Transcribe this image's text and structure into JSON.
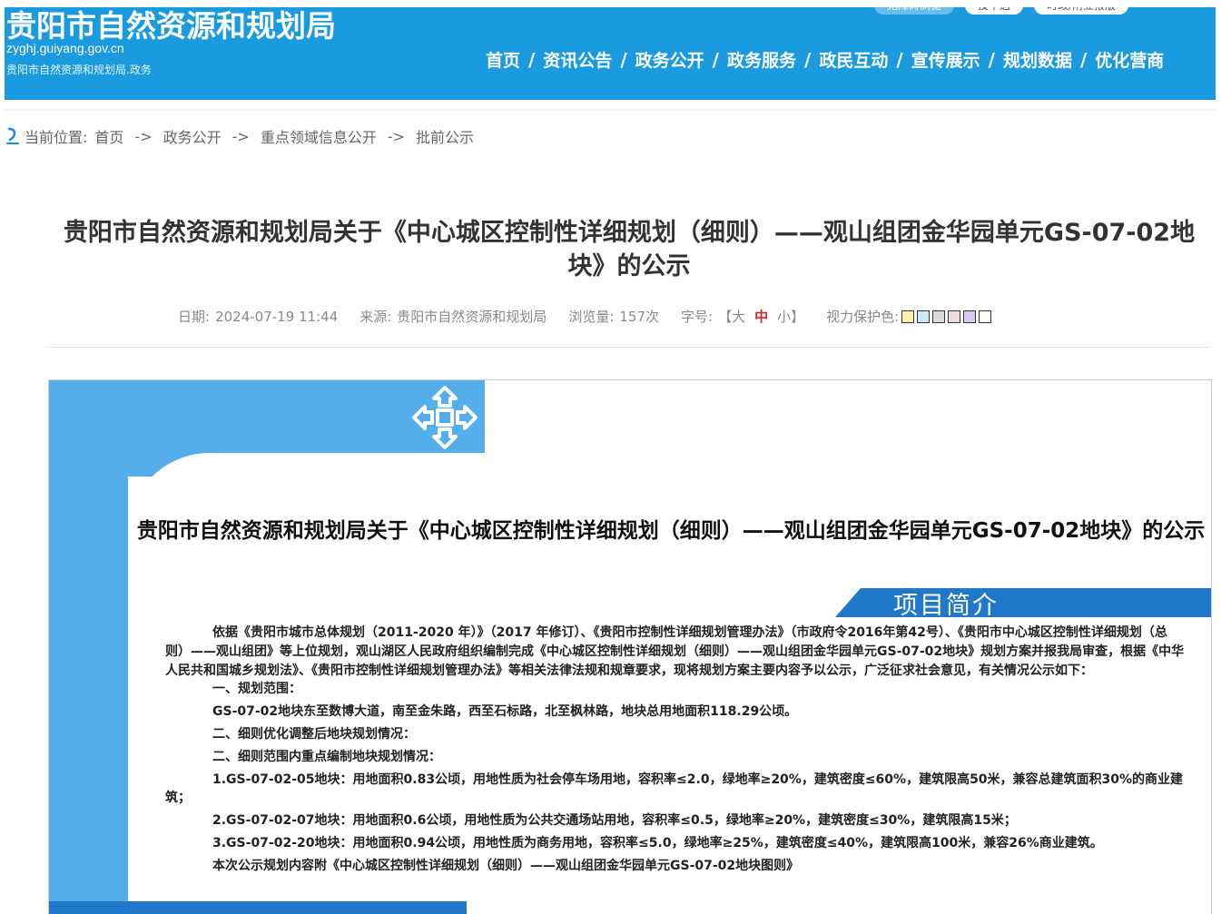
{
  "header": {
    "site_title": "贵阳市自然资源和规划局",
    "domain": "zyghj.guiyang.gov.cn",
    "subtitle": "贵阳市自然资源和规划局.政务",
    "top_tabs": [
      "无障碍浏览",
      "投中遇",
      "时政/附立报版"
    ],
    "nav": [
      "首页",
      "资讯公告",
      "政务公开",
      "政务服务",
      "政民互动",
      "宣传展示",
      "规划数据",
      "优化营商"
    ],
    "nav_separator": "/",
    "bg_color": "#1a9be0"
  },
  "breadcrumb": {
    "label": "当前位置:",
    "items": [
      "首页",
      "政务公开",
      "重点领域信息公开",
      "批前公示"
    ],
    "arrow": "->"
  },
  "article": {
    "title": "贵阳市自然资源和规划局关于《中心城区控制性详细规划（细则）——观山组团金华园单元GS-07-02地块》的公示",
    "date_label": "日期:",
    "date": "2024-07-19 11:44",
    "source_label": "来源:",
    "source": "贵阳市自然资源和规划局",
    "views_label": "浏览量:",
    "views": "157次",
    "font_label": "字号:",
    "font_open": "【大",
    "font_mid": "中",
    "font_close": "小】",
    "eye_label": "视力保护色:",
    "eye_colors": [
      "#fbf1a8",
      "#c9ecf6",
      "#dcdcdc",
      "#f2d9e6",
      "#d9c8f3",
      "#ffffff"
    ]
  },
  "poster": {
    "title": "贵阳市自然资源和规划局关于《中心城区控制性详细规划（细则）——观山组团金华园单元GS-07-02地块》的公示",
    "section": "项目简介",
    "intro": "依据《贵阳市城市总体规划（2011-2020 年）》（2017 年修订）、《贵阳市控制性详细规划管理办法》（市政府令2016年第42号）、《贵阳市中心城区控制性详细规划（总则）——观山组团》等上位规划，观山湖区人民政府组织编制完成《中心城区控制性详细规划（细则）——观山组团金华园单元GS-07-02地块》规划方案并报我局审查，根据《中华人民共和国城乡规划法》、《贵阳市控制性详细规划管理办法》等相关法律法规和规章要求，现将规划方案主要内容予以公示，广泛征求社会意见，有关情况公示如下：",
    "s1": "一、规划范围：",
    "s1_text": "GS-07-02地块东至数博大道，南至金朱路，西至石标路，北至枫林路，地块总用地面积118.29公顷。",
    "s2": "二、细则优化调整后地块规划情况：",
    "s3": "二、细则范围内重点编制地块规划情况：",
    "item1": "1.GS-07-02-05地块：用地面积0.83公顷，用地性质为社会停车场用地，容积率≤2.0，绿地率≥20%，建筑密度≤60%，建筑限高50米，兼容总建筑面积30%的商业建筑；",
    "item2": "2.GS-07-02-07地块：用地面积0.6公顷，用地性质为公共交通场站用地，容积率≤0.5，绿地率≥20%，建筑密度≤30%，建筑限高15米；",
    "item3": "3.GS-07-02-20地块：用地面积0.94公顷，用地性质为商务用地，容积率≤5.0，绿地率≥25%，建筑密度≤40%，建筑限高100米，兼容26%商业建筑。",
    "attachment": "本次公示规划内容附《中心城区控制性详细规划（细则）——观山组团金华园单元GS-07-02地块图则》"
  }
}
